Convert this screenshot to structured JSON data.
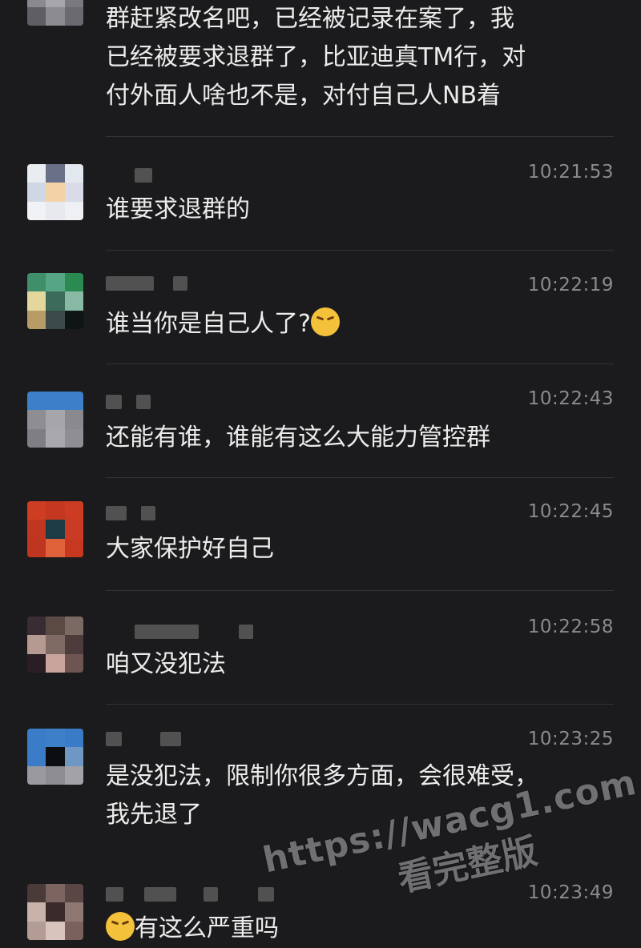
{
  "messages": [
    {
      "time": "",
      "text": "群赶紧改名吧，已经被记录在案了，我\n已经被要求退群了，比亚迪真TM行，对\n付外面人啥也不是，对付自己人NB着"
    },
    {
      "time": "10:21:53",
      "text": "谁要求退群的"
    },
    {
      "time": "10:22:19",
      "text": "谁当你是自己人了?"
    },
    {
      "time": "10:22:43",
      "text": "还能有谁，谁能有这么大能力管控群"
    },
    {
      "time": "10:22:45",
      "text": "大家保护好自己"
    },
    {
      "time": "10:22:58",
      "text": "咱又没犯法"
    },
    {
      "time": "10:23:25",
      "text": "是没犯法，限制你很多方面，会很难受，\n我先退了"
    },
    {
      "time": "10:23:49",
      "text": "有这么严重吗"
    }
  ],
  "watermark": {
    "url": "https://wacg1.com",
    "subtitle": "看完整版"
  },
  "icons": {
    "emoji_laugh": "laughing-crying-emoji-icon"
  }
}
